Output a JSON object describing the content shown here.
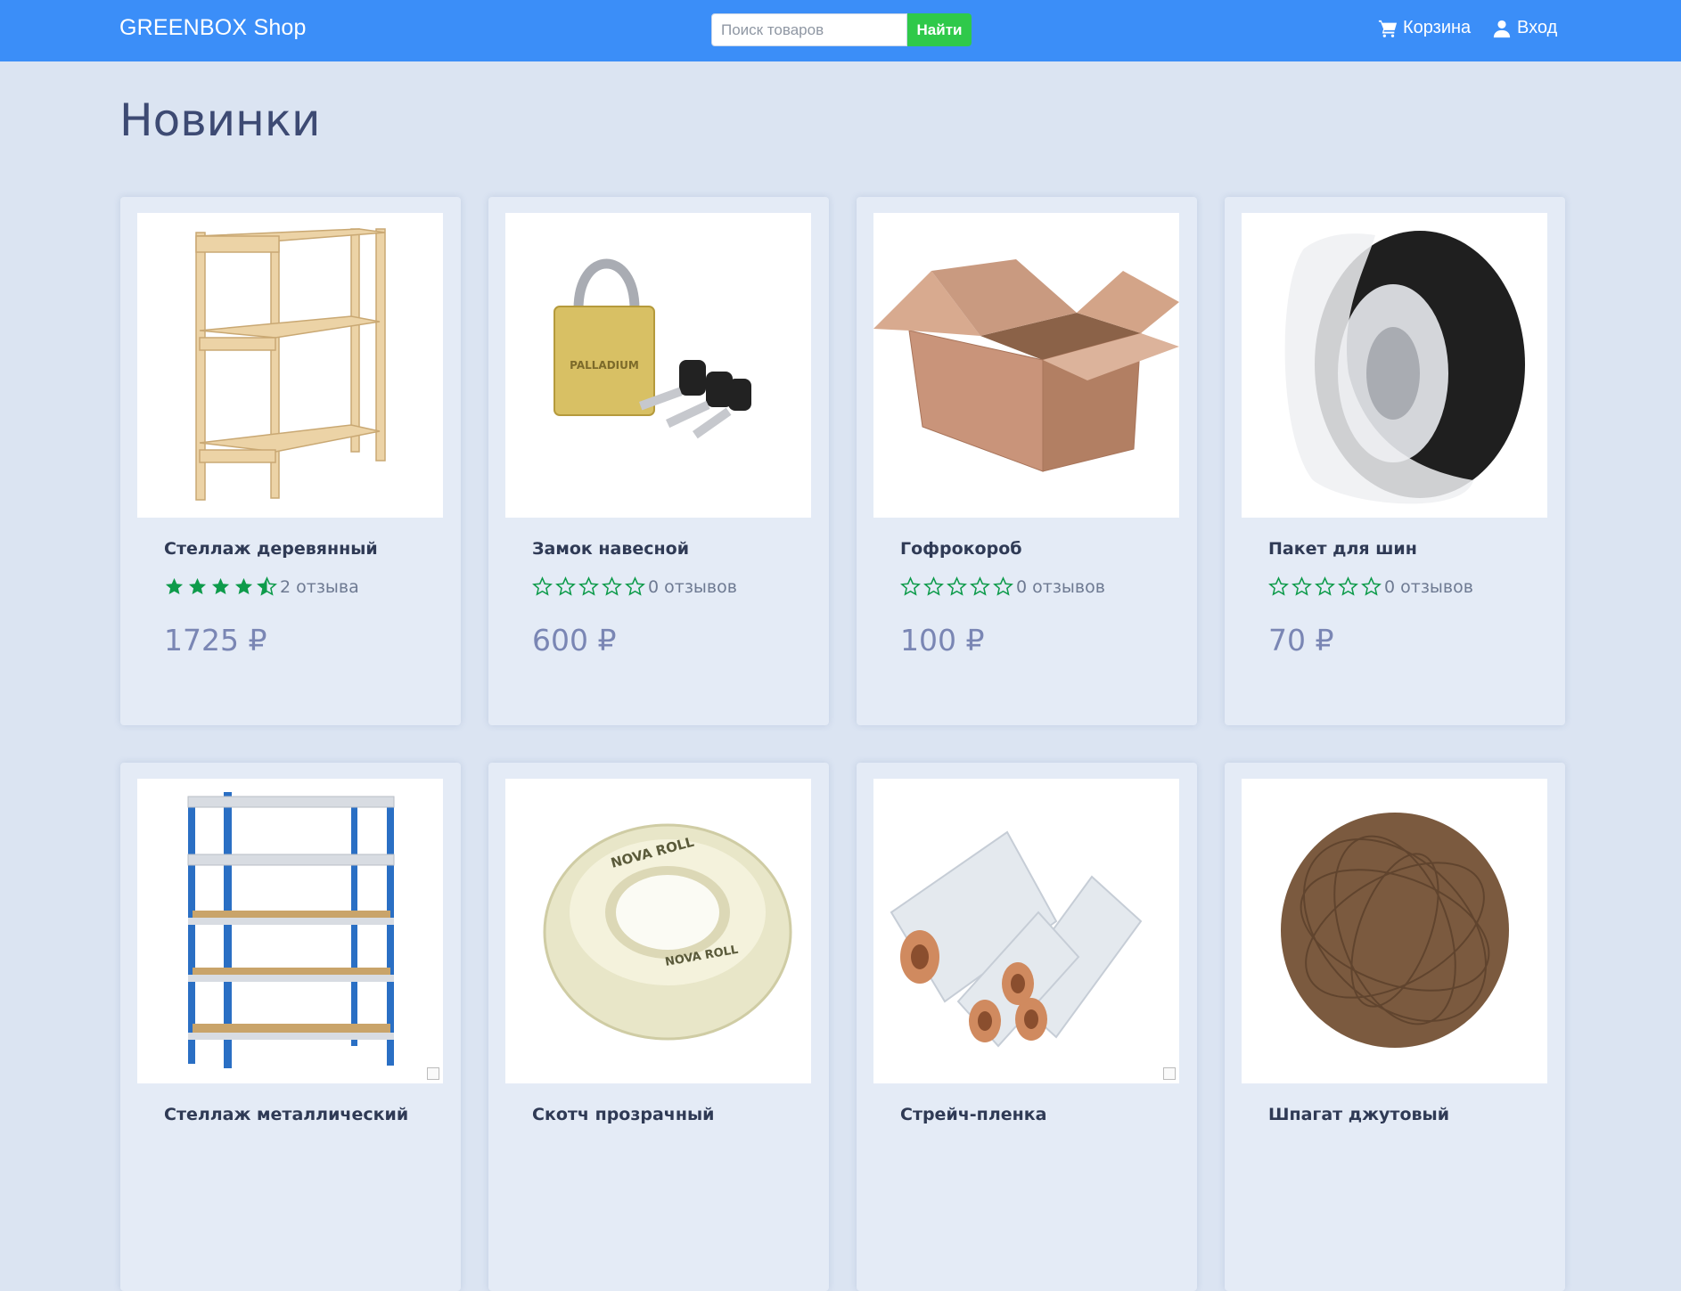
{
  "nav": {
    "brand": "GREENBOX Shop",
    "search_placeholder": "Поиск товаров",
    "search_button": "Найти",
    "cart_label": "Корзина",
    "login_label": "Вход"
  },
  "page": {
    "title": "Новинки"
  },
  "colors": {
    "navbar": "#3b8ef8",
    "search_button": "#2fc94a",
    "star": "#0e9b4b"
  },
  "products": [
    {
      "name": "Стеллаж деревянный",
      "rating": 4.5,
      "reviews": "2 отзыва",
      "price": "1725 ₽",
      "image": "wooden-shelf"
    },
    {
      "name": "Замок навесной",
      "rating": 0,
      "reviews": "0 отзывов",
      "price": "600 ₽",
      "image": "padlock"
    },
    {
      "name": "Гофрокороб",
      "rating": 0,
      "reviews": "0 отзывов",
      "price": "100 ₽",
      "image": "cardboard-box"
    },
    {
      "name": "Пакет для шин",
      "rating": 0,
      "reviews": "0 отзывов",
      "price": "70 ₽",
      "image": "tire-bag"
    },
    {
      "name": "Стеллаж металлический",
      "image": "metal-shelf"
    },
    {
      "name": "Скотч прозрачный",
      "image": "tape-roll"
    },
    {
      "name": "Стрейч-пленка",
      "image": "stretch-film"
    },
    {
      "name": "Шпагат джутовый",
      "image": "jute-twine"
    }
  ]
}
